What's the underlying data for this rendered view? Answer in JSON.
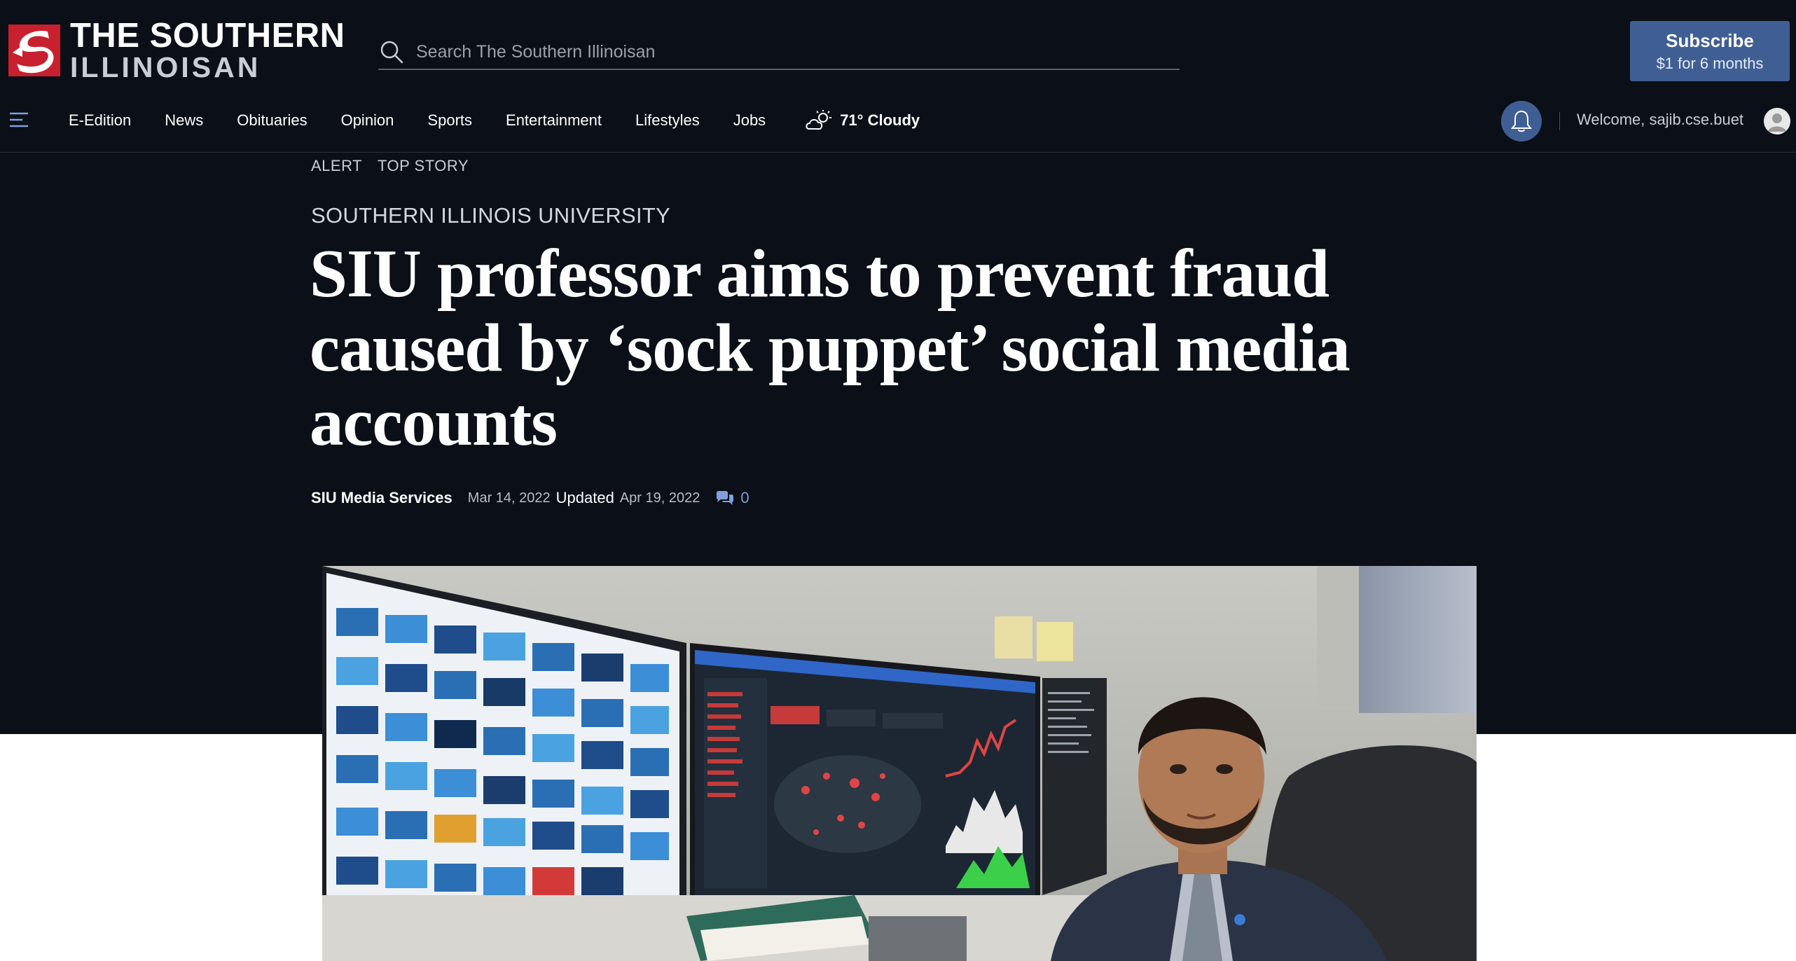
{
  "header": {
    "logo": {
      "line1": "THE SOUTHERN",
      "line2": "ILLINOISAN",
      "icon": "newspaper-logo-icon"
    },
    "search": {
      "placeholder": "Search The Southern Illinoisan",
      "icon": "search-icon"
    },
    "subscribe": {
      "label": "Subscribe",
      "offer": "$1 for 6 months"
    }
  },
  "nav": {
    "menu_icon": "hamburger-icon",
    "items": [
      {
        "label": "E-Edition"
      },
      {
        "label": "News"
      },
      {
        "label": "Obituaries"
      },
      {
        "label": "Opinion"
      },
      {
        "label": "Sports"
      },
      {
        "label": "Entertainment"
      },
      {
        "label": "Lifestyles"
      },
      {
        "label": "Jobs"
      }
    ],
    "weather": {
      "icon": "partly-cloudy-icon",
      "text": "71° Cloudy"
    },
    "notifications_icon": "bell-icon",
    "welcome": "Welcome, sajib.cse.buet",
    "avatar_icon": "user-avatar-icon"
  },
  "article": {
    "tags": [
      "ALERT",
      "TOP STORY"
    ],
    "section": "SOUTHERN ILLINOIS UNIVERSITY",
    "headline": "SIU professor aims to prevent fraud caused by ‘sock puppet’ social media accounts",
    "author": "SIU Media Services",
    "published": "Mar 14, 2022",
    "updated_label": "Updated",
    "updated": "Apr 19, 2022",
    "comment_count": "0",
    "comment_icon": "comments-icon"
  },
  "colors": {
    "background_dark": "#0b0f17",
    "accent_blue": "#3f5f94",
    "logo_red": "#c8202f",
    "comment_blue": "#7f9fdd"
  }
}
